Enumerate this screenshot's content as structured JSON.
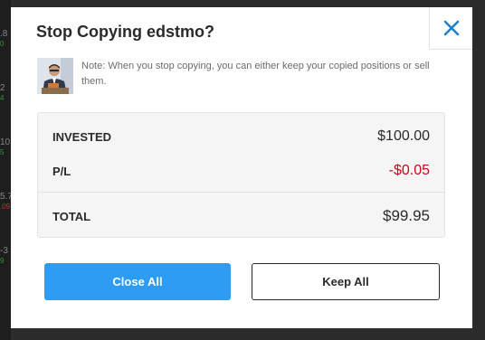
{
  "background": {
    "numbers": [
      {
        "main": ".8",
        "sub": "0"
      },
      {
        "main": "2",
        "sub": "4"
      },
      {
        "main": "10",
        "sub": "5"
      },
      {
        "main": "5.7",
        "sub": ".09"
      },
      {
        "main": "-3",
        "sub": "9"
      }
    ]
  },
  "modal": {
    "title": "Stop Copying edstmo?",
    "close_icon": "close-icon",
    "note": "Note: When you stop copying, you can either keep your copied positions or sell them.",
    "summary": {
      "invested_label": "INVESTED",
      "invested_value": "$100.00",
      "pl_label": "P/L",
      "pl_value": "-$0.05",
      "total_label": "TOTAL",
      "total_value": "$99.95"
    },
    "buttons": {
      "close_all": "Close All",
      "keep_all": "Keep All"
    }
  },
  "colors": {
    "primary": "#2d9cf2",
    "negative": "#d0021b",
    "close_icon": "#1f7fc6"
  }
}
